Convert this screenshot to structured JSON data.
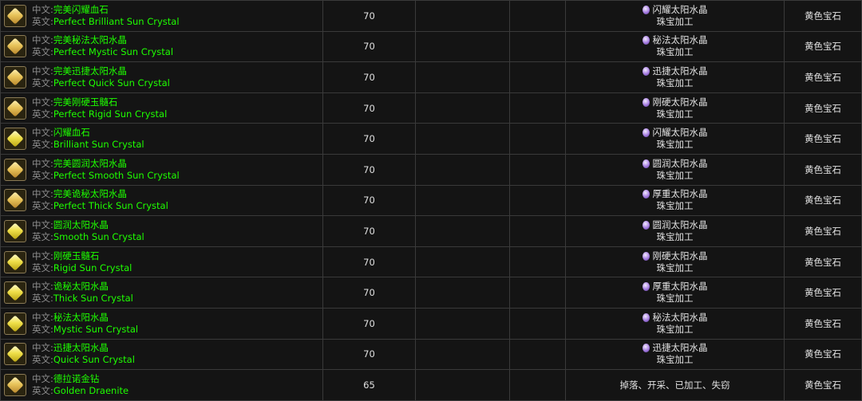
{
  "labels": {
    "cn": "中文:",
    "en": "英文:"
  },
  "rows": [
    {
      "icon": "orange",
      "cn": "完美闪耀血石",
      "en": "Perfect Brilliant Sun Crystal",
      "level": "70",
      "source": "闪耀太阳水晶",
      "method": "珠宝加工",
      "type": "黄色宝石"
    },
    {
      "icon": "orange",
      "cn": "完美秘法太阳水晶",
      "en": "Perfect Mystic Sun Crystal",
      "level": "70",
      "source": "秘法太阳水晶",
      "method": "珠宝加工",
      "type": "黄色宝石"
    },
    {
      "icon": "orange",
      "cn": "完美迅捷太阳水晶",
      "en": "Perfect Quick Sun Crystal",
      "level": "70",
      "source": "迅捷太阳水晶",
      "method": "珠宝加工",
      "type": "黄色宝石"
    },
    {
      "icon": "orange",
      "cn": "完美刚硬玉髓石",
      "en": "Perfect Rigid Sun Crystal",
      "level": "70",
      "source": "刚硬太阳水晶",
      "method": "珠宝加工",
      "type": "黄色宝石"
    },
    {
      "icon": "yellow",
      "cn": "闪耀血石",
      "en": "Brilliant Sun Crystal",
      "level": "70",
      "source": "闪耀太阳水晶",
      "method": "珠宝加工",
      "type": "黄色宝石"
    },
    {
      "icon": "orange",
      "cn": "完美圆润太阳水晶",
      "en": "Perfect Smooth Sun Crystal",
      "level": "70",
      "source": "圆润太阳水晶",
      "method": "珠宝加工",
      "type": "黄色宝石"
    },
    {
      "icon": "orange",
      "cn": "完美诡秘太阳水晶",
      "en": "Perfect Thick Sun Crystal",
      "level": "70",
      "source": "厚重太阳水晶",
      "method": "珠宝加工",
      "type": "黄色宝石"
    },
    {
      "icon": "yellow",
      "cn": "圆润太阳水晶",
      "en": "Smooth Sun Crystal",
      "level": "70",
      "source": "圆润太阳水晶",
      "method": "珠宝加工",
      "type": "黄色宝石"
    },
    {
      "icon": "yellow",
      "cn": "刚硬玉髓石",
      "en": "Rigid Sun Crystal",
      "level": "70",
      "source": "刚硬太阳水晶",
      "method": "珠宝加工",
      "type": "黄色宝石"
    },
    {
      "icon": "yellow",
      "cn": "诡秘太阳水晶",
      "en": "Thick Sun Crystal",
      "level": "70",
      "source": "厚重太阳水晶",
      "method": "珠宝加工",
      "type": "黄色宝石"
    },
    {
      "icon": "yellow",
      "cn": "秘法太阳水晶",
      "en": "Mystic Sun Crystal",
      "level": "70",
      "source": "秘法太阳水晶",
      "method": "珠宝加工",
      "type": "黄色宝石"
    },
    {
      "icon": "yellow",
      "cn": "迅捷太阳水晶",
      "en": "Quick Sun Crystal",
      "level": "70",
      "source": "迅捷太阳水晶",
      "method": "珠宝加工",
      "type": "黄色宝石"
    },
    {
      "icon": "orange",
      "cn": "德拉诺金钻",
      "en": "Golden Draenite",
      "level": "65",
      "source": "",
      "method": "掉落、开采、已加工、失窃",
      "type": "黄色宝石"
    }
  ]
}
